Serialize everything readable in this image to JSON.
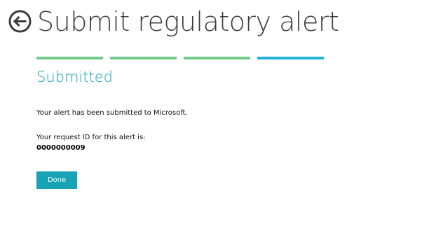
{
  "header": {
    "back_icon": "back-arrow-circle-icon",
    "title": "Submit regulatory alert"
  },
  "progress": {
    "steps_total": 4,
    "current_step": 4,
    "colors": {
      "completed": "#6ecb8a",
      "current": "#1fb3d6"
    }
  },
  "main": {
    "section_title": "Submitted",
    "section_title_color": "#17a3b5",
    "confirmation_text": "Your alert has been submitted to Microsoft.",
    "request_id_label": "Your request ID for this alert is:",
    "request_id_value": "0000000009",
    "done_label": "Done",
    "done_color": "#17a3b5"
  }
}
